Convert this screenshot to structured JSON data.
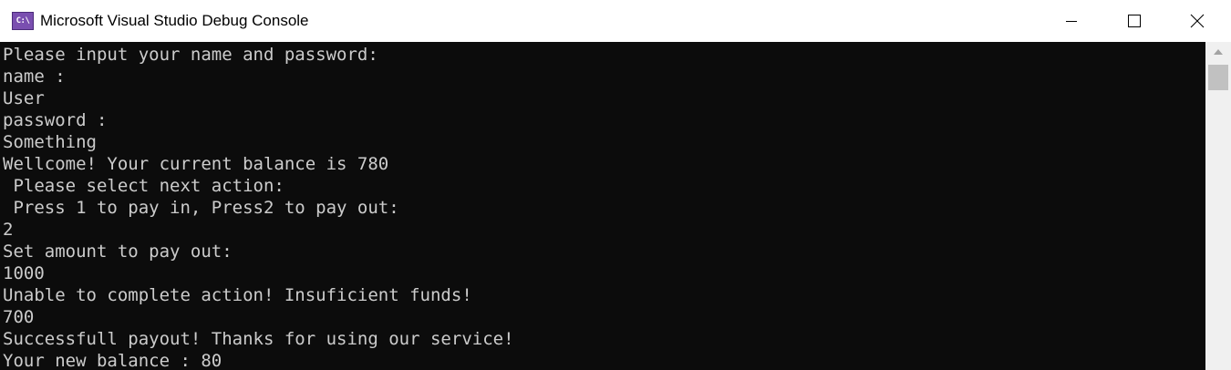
{
  "window": {
    "title": "Microsoft Visual Studio Debug Console",
    "icon_label": "C:\\",
    "icon": "console-app-icon",
    "controls": [
      "minimize-icon",
      "maximize-icon",
      "close-icon"
    ]
  },
  "console": {
    "background": "#0c0c0c",
    "foreground": "#cccccc",
    "lines": [
      "Please input your name and password:",
      "name :",
      "User",
      "password :",
      "Something",
      "Wellcome! Your current balance is 780",
      " Please select next action:",
      " Press 1 to pay in, Press2 to pay out:",
      "2",
      "Set amount to pay out:",
      "1000",
      "Unable to complete action! Insuficient funds!",
      "700",
      "Successfull payout! Thanks for using our service!",
      "Your new balance : 80"
    ]
  },
  "scrollbar": {
    "up_icon": "scroll-up-arrow-icon"
  }
}
